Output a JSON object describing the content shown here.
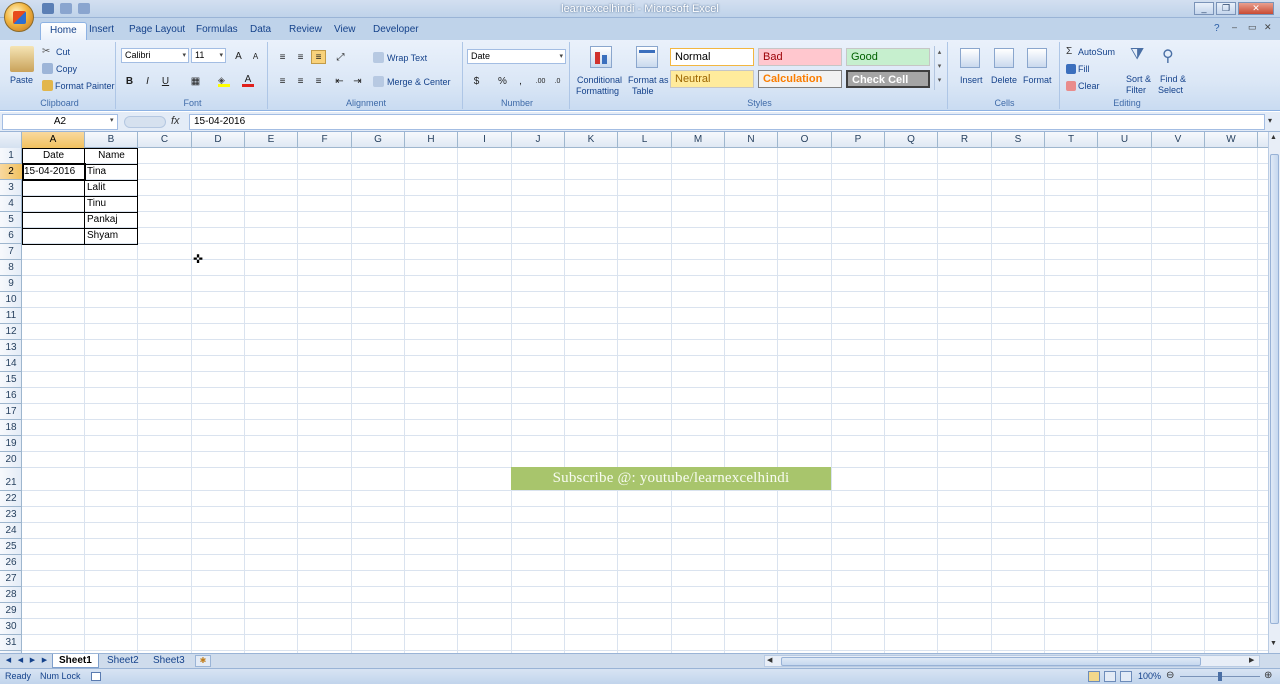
{
  "window": {
    "title": "learnexcelhindi - Microsoft Excel",
    "controls": [
      "_",
      "❐",
      "✕"
    ]
  },
  "tabs": [
    "Home",
    "Insert",
    "Page Layout",
    "Formulas",
    "Data",
    "Review",
    "View",
    "Developer"
  ],
  "active_tab": "Home",
  "ribbon": {
    "clipboard": {
      "paste": "Paste",
      "cut": "Cut",
      "copy": "Copy",
      "format_painter": "Format Painter",
      "label": "Clipboard"
    },
    "font": {
      "name": "Calibri",
      "size": "11",
      "bold": "B",
      "italic": "I",
      "underline": "U",
      "label": "Font"
    },
    "alignment": {
      "wrap_text": "Wrap Text",
      "merge_center": "Merge & Center",
      "label": "Alignment"
    },
    "number": {
      "format": "Date",
      "percent": "%",
      "label": "Number"
    },
    "styles": {
      "conditional": "Conditional\nFormatting",
      "conditional_l1": "Conditional",
      "conditional_l2": "Formatting",
      "format_table_l1": "Format as",
      "format_table_l2": "Table",
      "normal": "Normal",
      "bad": "Bad",
      "good": "Good",
      "neutral": "Neutral",
      "calculation": "Calculation",
      "check_cell": "Check Cell",
      "label": "Styles"
    },
    "cells": {
      "insert": "Insert",
      "delete": "Delete",
      "format": "Format",
      "label": "Cells"
    },
    "editing": {
      "autosum": "AutoSum",
      "fill": "Fill",
      "clear": "Clear",
      "sort_l1": "Sort &",
      "sort_l2": "Filter",
      "find_l1": "Find &",
      "find_l2": "Select",
      "label": "Editing"
    }
  },
  "formula_bar": {
    "name_box": "A2",
    "fx": "fx",
    "value": "15-04-2016"
  },
  "columns": [
    "A",
    "B",
    "C",
    "D",
    "E",
    "F",
    "G",
    "H",
    "I",
    "J",
    "K",
    "L",
    "M",
    "N",
    "O",
    "P",
    "Q",
    "R",
    "S",
    "T",
    "U",
    "V",
    "W"
  ],
  "rows": [
    "1",
    "2",
    "3",
    "4",
    "5",
    "6",
    "7",
    "8",
    "9",
    "10",
    "11",
    "12",
    "13",
    "14",
    "15",
    "16",
    "17",
    "18",
    "19",
    "20",
    "21",
    "22",
    "23",
    "24",
    "25",
    "26",
    "27",
    "28",
    "29",
    "30",
    "31"
  ],
  "cells": {
    "A1": "Date",
    "B1": "Name",
    "A2": "15-04-2016",
    "B2": "Tina",
    "B3": "Lalit",
    "B4": "Tinu",
    "B5": "Pankaj",
    "B6": "Shyam"
  },
  "banner": "Subscribe @: youtube/learnexcelhindi",
  "sheets": [
    "Sheet1",
    "Sheet2",
    "Sheet3"
  ],
  "active_sheet": "Sheet1",
  "status": {
    "ready": "Ready",
    "num_lock": "Num Lock",
    "zoom": "100%"
  },
  "colors": {
    "selected_header": "#f1c15f",
    "banner_bg": "#a8c56c",
    "ribbon_bg": "#dbe7f6"
  }
}
